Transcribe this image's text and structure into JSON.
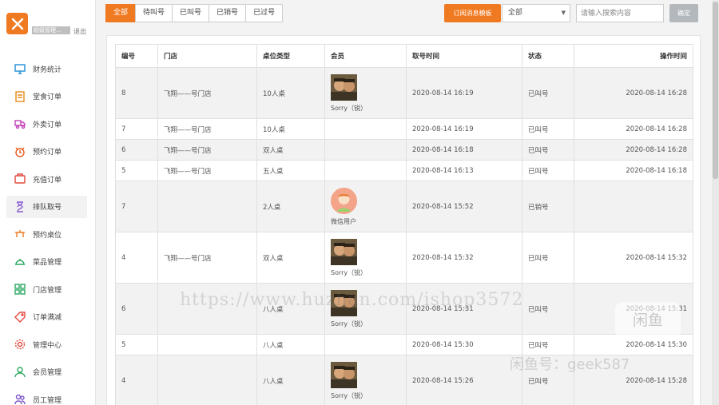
{
  "sidebar": {
    "shop_name": "超级管理...",
    "logout": "退出",
    "items": [
      {
        "label": "财务统计",
        "icon": "monitor-icon",
        "color": "#1f8fd4"
      },
      {
        "label": "堂食订单",
        "icon": "document-icon",
        "color": "#e88a1a"
      },
      {
        "label": "外卖订单",
        "icon": "delivery-icon",
        "color": "#c23fb7"
      },
      {
        "label": "预约订单",
        "icon": "alarm-clock-icon",
        "color": "#e45b1c"
      },
      {
        "label": "充值订单",
        "icon": "recharge-icon",
        "color": "#e2483d"
      },
      {
        "label": "排队取号",
        "icon": "hourglass-icon",
        "color": "#8a5cd1"
      },
      {
        "label": "预约桌位",
        "icon": "table-reserve-icon",
        "color": "#f07a22"
      },
      {
        "label": "菜品管理",
        "icon": "dish-icon",
        "color": "#2aa860"
      },
      {
        "label": "门店管理",
        "icon": "store-grid-icon",
        "color": "#2aa860"
      },
      {
        "label": "订单满减",
        "icon": "tag-icon",
        "color": "#e2483d"
      },
      {
        "label": "管理中心",
        "icon": "gear-icon",
        "color": "#e2483d"
      },
      {
        "label": "会员管理",
        "icon": "member-icon",
        "color": "#2aa860"
      },
      {
        "label": "员工管理",
        "icon": "staff-icon",
        "color": "#7b57c7"
      }
    ],
    "active_index": 5
  },
  "toolbar": {
    "tabs": [
      "全部",
      "待叫号",
      "已叫号",
      "已销号",
      "已过号"
    ],
    "active_tab": 0,
    "subscribe_label": "订阅消息模板",
    "status_select_value": "全部",
    "search_placeholder": "请输入搜索内容",
    "confirm_label": "确定"
  },
  "table": {
    "headers": [
      "编号",
      "门店",
      "桌位类型",
      "会员",
      "取号时间",
      "状态",
      "操作时间"
    ],
    "rows": [
      {
        "id": "8",
        "store": "飞翔——号门店",
        "table_type": "10人桌",
        "member": "Sorry（锐）",
        "avatar": "photo",
        "take_time": "2020-08-14 16:19",
        "status": "已叫号",
        "op_time": "2020-08-14 16:28"
      },
      {
        "id": "7",
        "store": "飞翔——号门店",
        "table_type": "10人桌",
        "member": "",
        "avatar": "",
        "take_time": "2020-08-14 16:19",
        "status": "已叫号",
        "op_time": "2020-08-14 16:28"
      },
      {
        "id": "6",
        "store": "飞翔——号门店",
        "table_type": "双人桌",
        "member": "",
        "avatar": "",
        "take_time": "2020-08-14 16:18",
        "status": "已叫号",
        "op_time": "2020-08-14 16:28"
      },
      {
        "id": "5",
        "store": "飞翔——号门店",
        "table_type": "五人桌",
        "member": "",
        "avatar": "",
        "take_time": "2020-08-14 16:13",
        "status": "已叫号",
        "op_time": "2020-08-14 16:18"
      },
      {
        "id": "7",
        "store": "",
        "table_type": "2人桌",
        "member": "微信用户",
        "avatar": "cartoon",
        "take_time": "2020-08-14 15:52",
        "status": "已销号",
        "op_time": ""
      },
      {
        "id": "4",
        "store": "飞翔——号门店",
        "table_type": "双人桌",
        "member": "Sorry（锐）",
        "avatar": "photo",
        "take_time": "2020-08-14 15:32",
        "status": "已叫号",
        "op_time": "2020-08-14 15:32"
      },
      {
        "id": "6",
        "store": "",
        "table_type": "八人桌",
        "member": "Sorry（锐）",
        "avatar": "photo",
        "take_time": "2020-08-14 15:31",
        "status": "已叫号",
        "op_time": "2020-08-14 15:31"
      },
      {
        "id": "5",
        "store": "",
        "table_type": "八人桌",
        "member": "",
        "avatar": "",
        "take_time": "2020-08-14 15:30",
        "status": "已叫号",
        "op_time": "2020-08-14 15:30"
      },
      {
        "id": "4",
        "store": "",
        "table_type": "八人桌",
        "member": "Sorry（锐）",
        "avatar": "photo",
        "take_time": "2020-08-14 15:26",
        "status": "已叫号",
        "op_time": "2020-08-14 15:28"
      }
    ]
  },
  "watermark": {
    "url": "https://www.huzhan.com/ishop3572",
    "badge": "闲鱼",
    "seller": "闲鱼号：geek587"
  }
}
